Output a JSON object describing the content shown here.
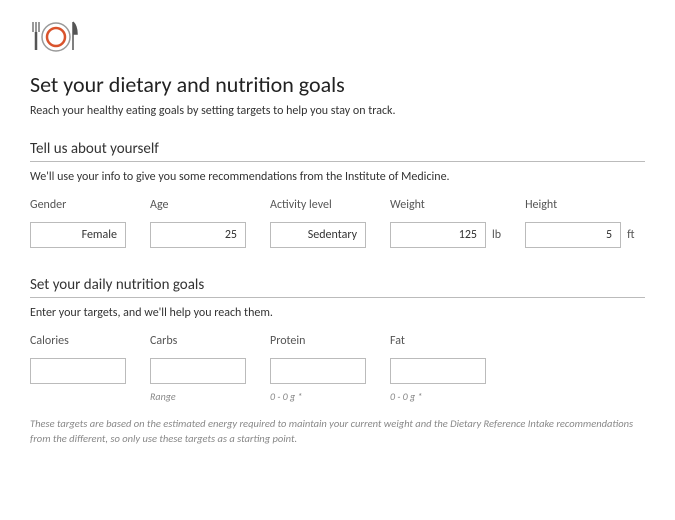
{
  "title": "Set your dietary and nutrition goals",
  "subtitle": "Reach your healthy eating goals by setting targets to help you stay on track.",
  "section1": {
    "heading": "Tell us about yourself",
    "desc": "We'll use your info to give you some recommendations from the Institute of Medicine.",
    "fields": {
      "gender": {
        "label": "Gender",
        "value": "Female"
      },
      "age": {
        "label": "Age",
        "value": "25"
      },
      "activity": {
        "label": "Activity level",
        "value": "Sedentary"
      },
      "weight": {
        "label": "Weight",
        "value": "125",
        "unit": "lb"
      },
      "height": {
        "label": "Height",
        "value": "5",
        "unit": "ft"
      }
    }
  },
  "section2": {
    "heading": "Set your daily nutrition goals",
    "desc": "Enter your targets, and we'll help you reach them.",
    "fields": {
      "calories": {
        "label": "Calories",
        "value": "",
        "hint": ""
      },
      "carbs": {
        "label": "Carbs",
        "value": "",
        "hint": "Range"
      },
      "protein": {
        "label": "Protein",
        "value": "",
        "hint": "0 - 0 g *"
      },
      "fat": {
        "label": "Fat",
        "value": "",
        "hint": "0 - 0 g *"
      }
    }
  },
  "footnote": "These targets are based on the estimated energy required to maintain your current weight and the Dietary Reference Intake recommendations from the different, so only use these targets as a starting point."
}
